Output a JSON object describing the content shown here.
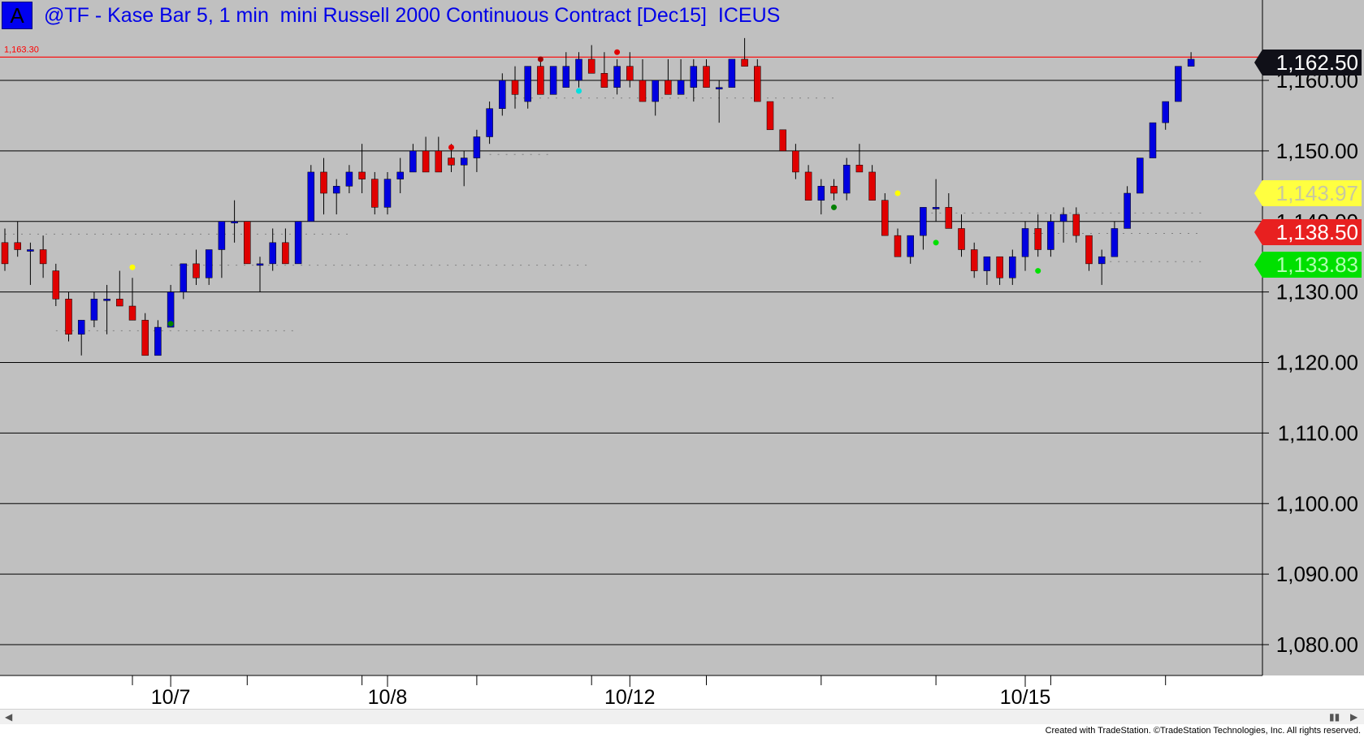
{
  "title": {
    "letter": "A",
    "text": "@TF - Kase Bar 5, 1 min  mini Russell 2000 Continuous Contract [Dec15]  ICEUS"
  },
  "colors": {
    "background": "#c0c0c0",
    "up_bar": "#0000e0",
    "down_bar": "#e00000",
    "reference_line": "#ff0000",
    "grid": "#000000"
  },
  "reference_line": {
    "value": 1163.3,
    "label": "1,163.30"
  },
  "badges": [
    {
      "label": "1,162.50",
      "value": 1162.5,
      "bg": "#101018",
      "fg": "#ffffff"
    },
    {
      "label": "1,143.97",
      "value": 1143.97,
      "bg": "#ffff40",
      "fg": "#c8c8a0"
    },
    {
      "label": "1,138.50",
      "value": 1138.5,
      "bg": "#e82020",
      "fg": "#ffffff"
    },
    {
      "label": "1,133.83",
      "value": 1133.83,
      "bg": "#00e000",
      "fg": "#b0ffb0"
    }
  ],
  "chart_data": {
    "type": "candlestick",
    "ylim": [
      1075,
      1167
    ],
    "y_ticks": [
      1080,
      1090,
      1100,
      1110,
      1120,
      1130,
      1140,
      1150,
      1160
    ],
    "y_tick_labels": [
      "1,080.00",
      "1,090.00",
      "1,100.00",
      "1,110.00",
      "1,120.00",
      "1,130.00",
      "1,140.00",
      "1,150.00",
      "1,160.00"
    ],
    "x_labels": [
      {
        "label": "10/7",
        "bar": 13
      },
      {
        "label": "10/8",
        "bar": 30
      },
      {
        "label": "10/12",
        "bar": 49
      },
      {
        "label": "10/15",
        "bar": 80
      }
    ],
    "candles": [
      [
        1137,
        1139,
        1133,
        1134
      ],
      [
        1137,
        1140,
        1135,
        1136
      ],
      [
        1136,
        1137,
        1131,
        1136
      ],
      [
        1136,
        1138,
        1132,
        1134
      ],
      [
        1133,
        1134,
        1128,
        1129
      ],
      [
        1129,
        1130,
        1123,
        1124
      ],
      [
        1124,
        1126,
        1121,
        1126
      ],
      [
        1126,
        1130,
        1125,
        1129
      ],
      [
        1129,
        1131,
        1124,
        1129
      ],
      [
        1129,
        1133,
        1128,
        1128
      ],
      [
        1128,
        1132,
        1126,
        1126
      ],
      [
        1126,
        1127,
        1121,
        1121
      ],
      [
        1121,
        1126,
        1121,
        1125
      ],
      [
        1125,
        1131,
        1125,
        1130
      ],
      [
        1130,
        1134,
        1129,
        1134
      ],
      [
        1134,
        1136,
        1131,
        1132
      ],
      [
        1132,
        1136,
        1131,
        1136
      ],
      [
        1136,
        1140,
        1132,
        1140
      ],
      [
        1140,
        1143,
        1137,
        1140
      ],
      [
        1140,
        1140,
        1134,
        1134
      ],
      [
        1134,
        1135,
        1130,
        1134
      ],
      [
        1134,
        1139,
        1133,
        1137
      ],
      [
        1137,
        1139,
        1134,
        1134
      ],
      [
        1134,
        1140,
        1134,
        1140
      ],
      [
        1140,
        1148,
        1140,
        1147
      ],
      [
        1147,
        1149,
        1141,
        1144
      ],
      [
        1144,
        1146,
        1141,
        1145
      ],
      [
        1145,
        1148,
        1144,
        1147
      ],
      [
        1147,
        1151,
        1144,
        1146
      ],
      [
        1146,
        1147,
        1141,
        1142
      ],
      [
        1142,
        1147,
        1141,
        1146
      ],
      [
        1146,
        1149,
        1144,
        1147
      ],
      [
        1147,
        1151,
        1147,
        1150
      ],
      [
        1150,
        1152,
        1147,
        1147
      ],
      [
        1150,
        1152,
        1147,
        1147
      ],
      [
        1149,
        1151,
        1147,
        1148
      ],
      [
        1148,
        1150,
        1145,
        1149
      ],
      [
        1149,
        1153,
        1147,
        1152
      ],
      [
        1152,
        1157,
        1151,
        1156
      ],
      [
        1156,
        1161,
        1155,
        1160
      ],
      [
        1160,
        1162,
        1156,
        1158
      ],
      [
        1157,
        1162,
        1156,
        1162
      ],
      [
        1162,
        1163,
        1158,
        1158
      ],
      [
        1158,
        1162,
        1158,
        1162
      ],
      [
        1159,
        1164,
        1159,
        1162
      ],
      [
        1160,
        1164,
        1159,
        1163
      ],
      [
        1163,
        1165,
        1161,
        1161
      ],
      [
        1161,
        1164,
        1159,
        1159
      ],
      [
        1159,
        1163,
        1158,
        1162
      ],
      [
        1162,
        1164,
        1159,
        1160
      ],
      [
        1160,
        1163,
        1157,
        1157
      ],
      [
        1157,
        1160,
        1155,
        1160
      ],
      [
        1160,
        1163,
        1158,
        1158
      ],
      [
        1158,
        1163,
        1158,
        1160
      ],
      [
        1159,
        1163,
        1157,
        1162
      ],
      [
        1162,
        1163,
        1159,
        1159
      ],
      [
        1159,
        1160,
        1154,
        1159
      ],
      [
        1159,
        1163,
        1159,
        1163
      ],
      [
        1163,
        1166,
        1162,
        1162
      ],
      [
        1162,
        1163,
        1157,
        1157
      ],
      [
        1157,
        1157,
        1153,
        1153
      ],
      [
        1153,
        1153,
        1150,
        1150
      ],
      [
        1150,
        1151,
        1146,
        1147
      ],
      [
        1147,
        1148,
        1143,
        1143
      ],
      [
        1143,
        1146,
        1141,
        1145
      ],
      [
        1145,
        1146,
        1143,
        1144
      ],
      [
        1144,
        1149,
        1143,
        1148
      ],
      [
        1148,
        1151,
        1147,
        1147
      ],
      [
        1147,
        1148,
        1143,
        1143
      ],
      [
        1143,
        1144,
        1138,
        1138
      ],
      [
        1138,
        1139,
        1135,
        1135
      ],
      [
        1135,
        1138,
        1134,
        1138
      ],
      [
        1138,
        1142,
        1136,
        1142
      ],
      [
        1142,
        1146,
        1140,
        1142
      ],
      [
        1142,
        1144,
        1139,
        1139
      ],
      [
        1139,
        1141,
        1135,
        1136
      ],
      [
        1136,
        1137,
        1132,
        1133
      ],
      [
        1133,
        1135,
        1131,
        1135
      ],
      [
        1135,
        1135,
        1131,
        1132
      ],
      [
        1132,
        1136,
        1131,
        1135
      ],
      [
        1135,
        1140,
        1133,
        1139
      ],
      [
        1139,
        1141,
        1135,
        1136
      ],
      [
        1136,
        1141,
        1135,
        1140
      ],
      [
        1140,
        1142,
        1137,
        1141
      ],
      [
        1141,
        1142,
        1137,
        1138
      ],
      [
        1138,
        1138,
        1133,
        1134
      ],
      [
        1134,
        1136,
        1131,
        1135
      ],
      [
        1135,
        1140,
        1135,
        1139
      ],
      [
        1139,
        1145,
        1139,
        1144
      ],
      [
        1144,
        1149,
        1144,
        1149
      ],
      [
        1149,
        1154,
        1149,
        1154
      ],
      [
        1154,
        1157,
        1153,
        1157
      ],
      [
        1157,
        1162,
        1157,
        1162
      ],
      [
        1162,
        1164,
        1162,
        1163
      ]
    ],
    "signal_dots": [
      {
        "bar": 10,
        "value": 1133.5,
        "color": "#ffff00"
      },
      {
        "bar": 13,
        "value": 1125.5,
        "color": "#008000"
      },
      {
        "bar": 35,
        "value": 1150.5,
        "color": "#e00000"
      },
      {
        "bar": 42,
        "value": 1163.0,
        "color": "#a00000"
      },
      {
        "bar": 45,
        "value": 1158.5,
        "color": "#00e0e0"
      },
      {
        "bar": 48,
        "value": 1164.0,
        "color": "#e00000"
      },
      {
        "bar": 65,
        "value": 1142.0,
        "color": "#008000"
      },
      {
        "bar": 70,
        "value": 1144.0,
        "color": "#ffff00"
      },
      {
        "bar": 73,
        "value": 1137.0,
        "color": "#00e000"
      },
      {
        "bar": 81,
        "value": 1133.0,
        "color": "#00e000"
      }
    ],
    "dotted_levels": [
      {
        "from": 0,
        "to": 27,
        "value": 1138.2
      },
      {
        "from": 13,
        "to": 46,
        "value": 1133.8
      },
      {
        "from": 4,
        "to": 23,
        "value": 1124.5
      },
      {
        "from": 40,
        "to": 65,
        "value": 1157.5
      },
      {
        "from": 38,
        "to": 43,
        "value": 1149.5
      },
      {
        "from": 72,
        "to": 94,
        "value": 1141.2
      },
      {
        "from": 80,
        "to": 94,
        "value": 1138.3
      },
      {
        "from": 86,
        "to": 94,
        "value": 1134.3
      }
    ]
  },
  "footer": "Created with TradeStation. ©TradeStation Technologies, Inc. All rights reserved."
}
